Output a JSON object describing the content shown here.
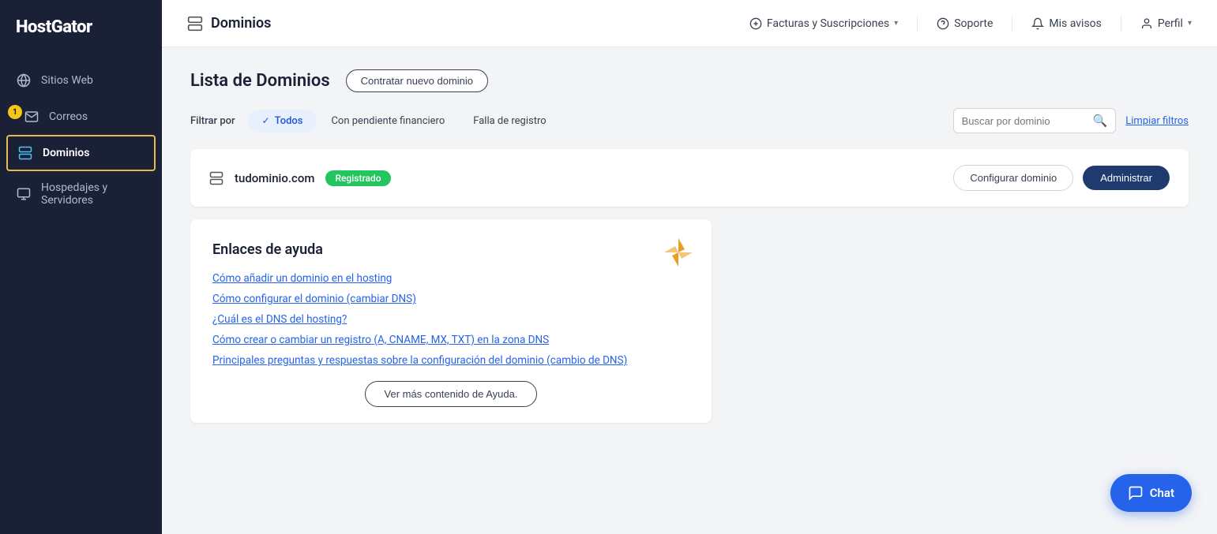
{
  "sidebar": {
    "logo": "HostGator",
    "items": [
      {
        "id": "sitios-web",
        "label": "Sitios Web",
        "icon": "globe"
      },
      {
        "id": "correos",
        "label": "Correos",
        "icon": "mail",
        "badge": "1"
      },
      {
        "id": "dominios",
        "label": "Dominios",
        "icon": "server",
        "active": true
      },
      {
        "id": "hospedajes",
        "label": "Hospedajes y Servidores",
        "icon": "server2"
      }
    ]
  },
  "header": {
    "title": "Dominios",
    "nav": [
      {
        "id": "facturas",
        "label": "Facturas y Suscripciones",
        "has_dropdown": true,
        "icon": "dollar"
      },
      {
        "id": "soporte",
        "label": "Soporte",
        "icon": "question"
      },
      {
        "id": "avisos",
        "label": "Mis avisos",
        "icon": "bell"
      },
      {
        "id": "perfil",
        "label": "Perfil",
        "has_dropdown": true,
        "icon": "user"
      }
    ]
  },
  "page": {
    "domain_list_title": "Lista de Dominios",
    "btn_new_domain": "Contratar nuevo dominio",
    "filter_label": "Filtrar por",
    "filters": [
      {
        "id": "todos",
        "label": "Todos",
        "active": true
      },
      {
        "id": "pendiente",
        "label": "Con pendiente financiero",
        "active": false
      },
      {
        "id": "falla",
        "label": "Falla de registro",
        "active": false
      }
    ],
    "search_placeholder": "Buscar por dominio",
    "clear_filters": "Limpiar filtros",
    "domains": [
      {
        "name": "tudominio.com",
        "status": "Registrado",
        "btn_configure": "Configurar dominio",
        "btn_manage": "Administrar"
      }
    ],
    "help": {
      "title": "Enlaces de ayuda",
      "links": [
        "Cómo añadir un dominio en el hosting",
        "Cómo configurar el dominio (cambiar DNS)",
        "¿Cuál es el DNS del hosting?",
        "Cómo crear o cambiar un registro (A, CNAME, MX, TXT) en la zona DNS",
        "Principales preguntas y respuestas sobre la configuración del dominio (cambio de DNS)"
      ],
      "btn_more": "Ver más contenido de Ayuda."
    },
    "chat_label": "Chat"
  }
}
